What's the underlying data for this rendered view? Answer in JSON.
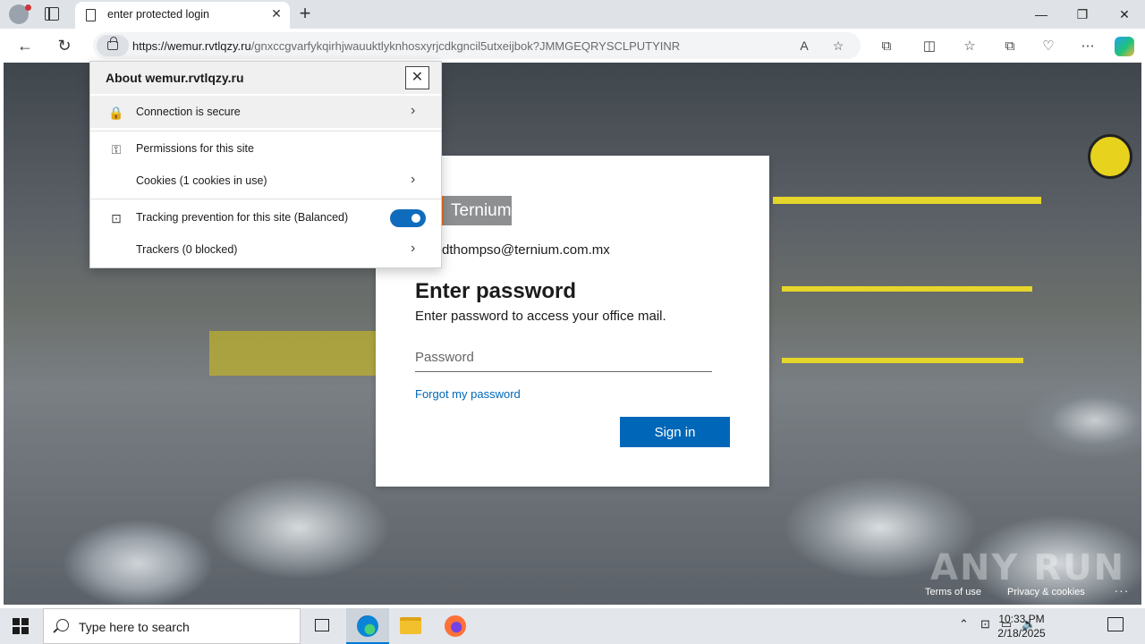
{
  "browser": {
    "tab_title": "enter protected login",
    "url_domain": "https://wemur.rvtlqzy.ru",
    "url_path": "/gnxccgvarfykqirhjwauuktlyknhosxyrjcdkgncil5utxeijbok?JMMGEQRYSCLPUTYINR"
  },
  "site_info": {
    "title": "About wemur.rvtlqzy.ru",
    "rows": [
      {
        "label": "Connection is secure"
      },
      {
        "label": "Permissions for this site"
      },
      {
        "label": "Cookies (1 cookies in use)"
      },
      {
        "label": "Tracking prevention for this site (Balanced)"
      },
      {
        "label": "Trackers (0 blocked)"
      }
    ],
    "tracking_toggle_on": true
  },
  "login": {
    "logo_text": "Ternium",
    "email": "dthompso@ternium.com.mx",
    "heading": "Enter password",
    "subtext": "Enter password to access your office mail.",
    "password_placeholder": "Password",
    "forgot_label": "Forgot my password",
    "signin_label": "Sign in"
  },
  "footer": {
    "terms": "Terms of use",
    "privacy": "Privacy & cookies",
    "more": "...",
    "watermark": "ANY RUN"
  },
  "taskbar": {
    "search_placeholder": "Type here to search",
    "time": "10:33 PM",
    "date": "2/18/2025"
  },
  "colors": {
    "accent": "#0067b8",
    "toggle": "#0f6cbd",
    "logo_orange": "#e96b1c"
  }
}
